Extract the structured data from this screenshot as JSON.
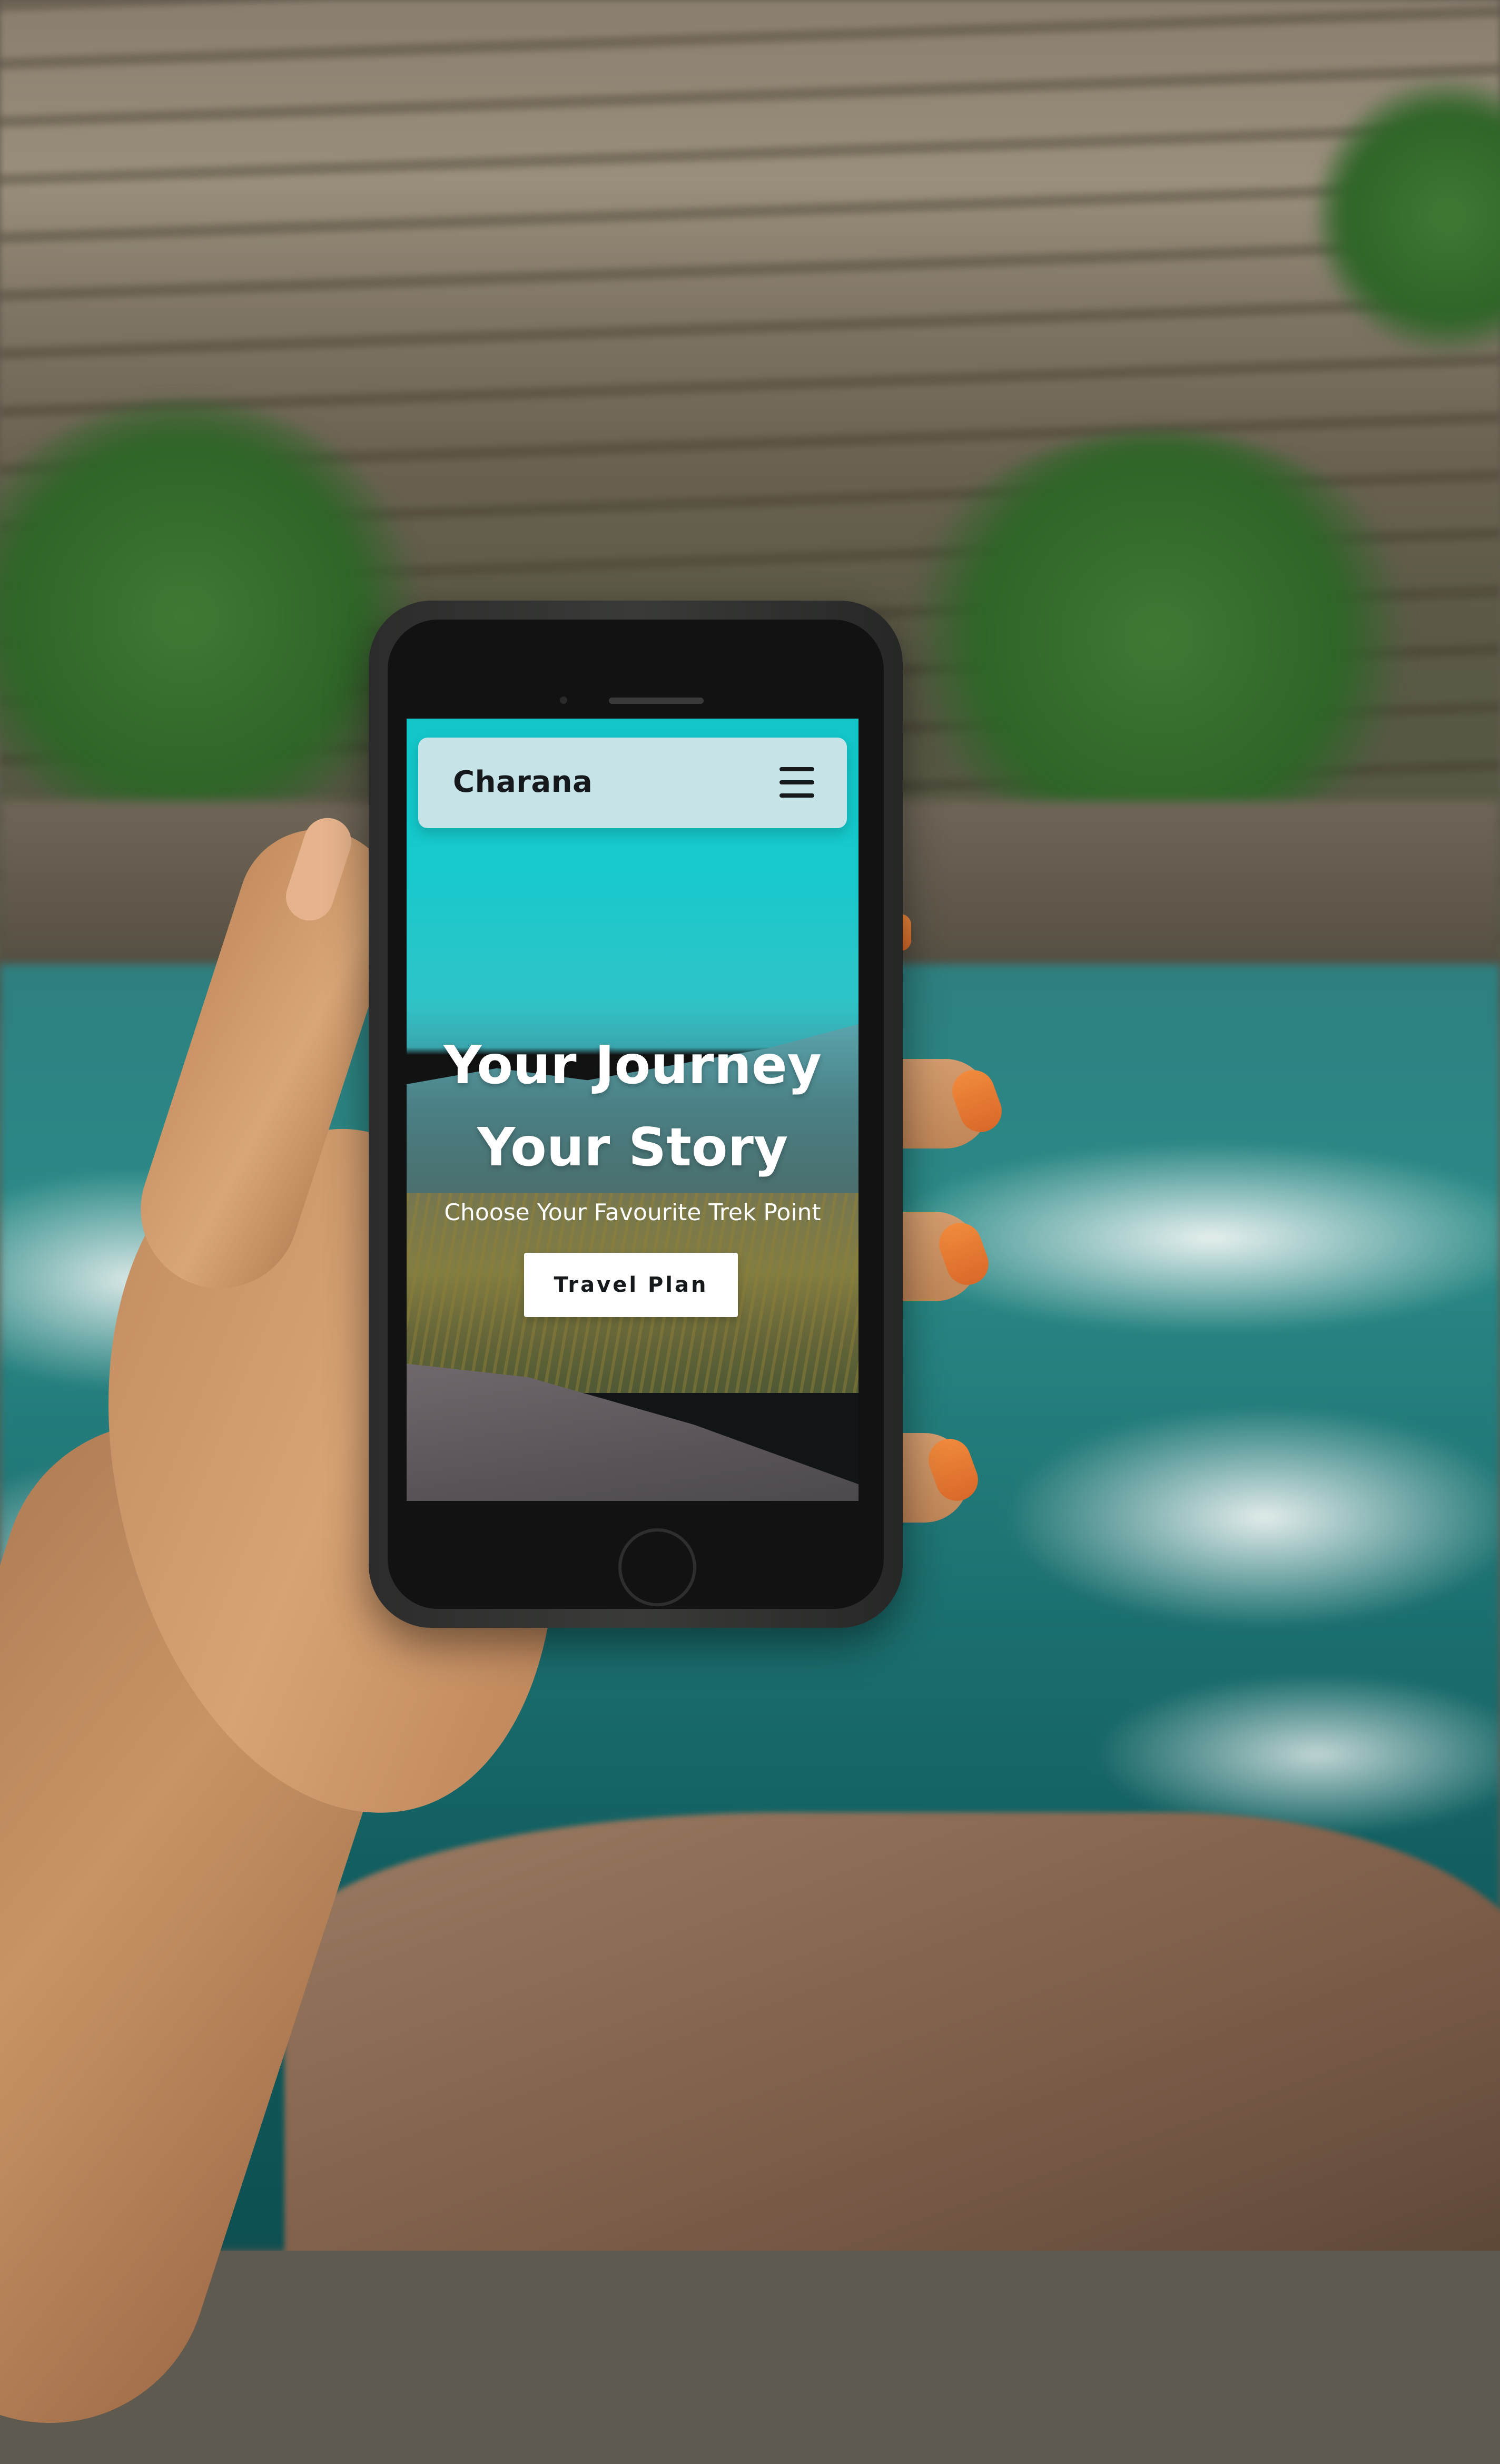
{
  "navbar": {
    "brand": "Charana",
    "menu_icon": "hamburger-menu-icon"
  },
  "hero": {
    "title_line1": "Your Journey",
    "title_line2": "Your Story",
    "subtitle": "Choose Your Favourite Trek Point",
    "cta_label": "Travel Plan"
  },
  "colors": {
    "navbar_bg": "#c6e4e8",
    "sky": "#12c6c8",
    "button_bg": "#ffffff",
    "text_dark": "#15191c"
  }
}
